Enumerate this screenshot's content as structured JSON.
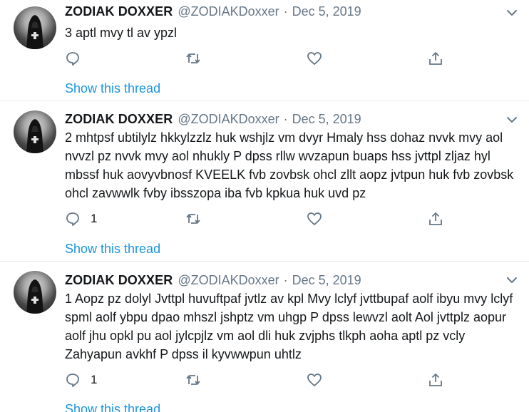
{
  "tweets": [
    {
      "display_name": "ZODIAK DOXXER",
      "handle": "@ZODIAKDoxxer",
      "separator": "·",
      "date": "Dec 5, 2019",
      "text": "3 aptl mvy tl av ypzl",
      "reply_count": "",
      "show_thread": "Show this thread"
    },
    {
      "display_name": "ZODIAK DOXXER",
      "handle": "@ZODIAKDoxxer",
      "separator": "·",
      "date": "Dec 5, 2019",
      "text": "2 mhtpsf  ubtilylz hkkylzzlz huk wshjlz vm dvyr Hmaly hss dohaz nvvk mvy aol nvvzl pz nvvk mvy aol nhukly P dpss rllw wvzapun buaps hss jvttpl zljaz hyl mbssf huk aovyvbnosf KVEELK fvb zovbsk ohcl zllt aopz jvtpun huk fvb zovbsk ohcl zavwwlk fvby ibsszopa iba fvb kpkua huk uvd pz",
      "reply_count": "1",
      "show_thread": "Show this thread"
    },
    {
      "display_name": "ZODIAK DOXXER",
      "handle": "@ZODIAKDoxxer",
      "separator": "·",
      "date": "Dec 5, 2019",
      "text": "1 Aopz pz dolyl Jvttpl huvuftpaf jvtlz av kpl Mvy lclyf jvttbupaf aolf ibyu mvy lclyf spml aolf ybpu dpao mhszl jshptz vm uhgp P dpss lewvzl aolt Aol jvttplz aopur aolf jhu opkl pu aol jylcpjlz vm aol dli huk zvjphs tlkph aoha aptl pz vcly Zahyapun avkhf P dpss il kyvwwpun uhtlz",
      "reply_count": "1",
      "show_thread": "Show this thread"
    }
  ],
  "colors": {
    "link": "#1b95e0",
    "secondary_text": "#657786",
    "divider": "#e6ecf0"
  },
  "icons": {
    "reply": "reply-icon",
    "retweet": "retweet-icon",
    "like": "heart-icon",
    "share": "share-icon",
    "caret": "chevron-down-icon"
  }
}
